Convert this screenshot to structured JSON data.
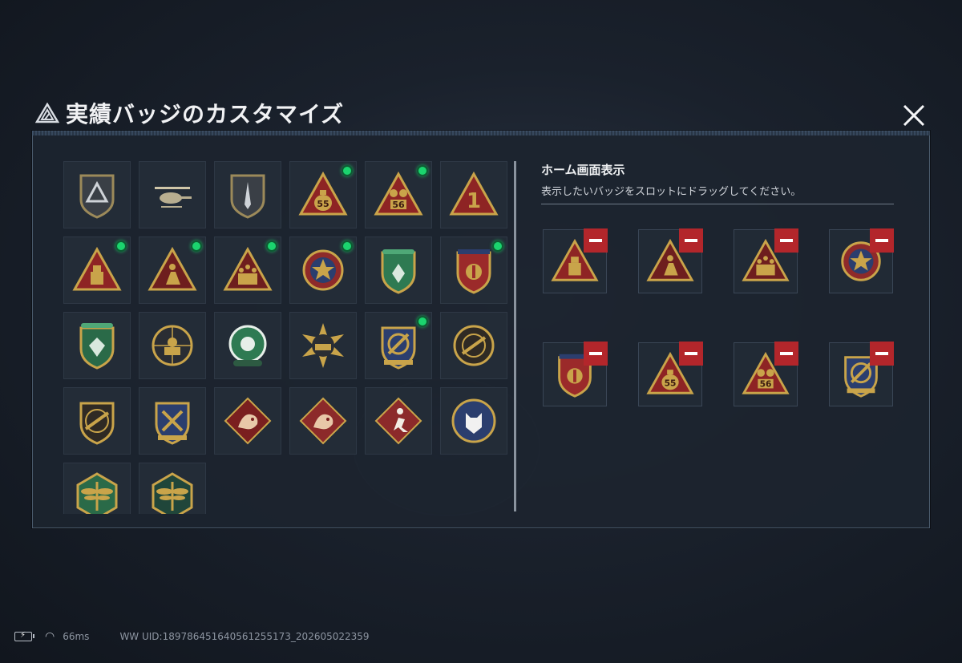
{
  "header": {
    "title": "実績バッジのカスタマイズ"
  },
  "right_panel": {
    "title": "ホーム画面表示",
    "description": "表示したいバッジをスロットにドラッグしてください。"
  },
  "badges": [
    {
      "icon": "delta-shield-badge-icon",
      "new": false
    },
    {
      "icon": "helicopter-badge-icon",
      "new": false
    },
    {
      "icon": "dagger-shield-badge-icon",
      "new": false
    },
    {
      "icon": "money-bag-55-badge-icon",
      "new": true,
      "label": "55"
    },
    {
      "icon": "chest-56-badge-icon",
      "new": true,
      "label": "56"
    },
    {
      "icon": "number-one-badge-icon",
      "new": false,
      "label": "1"
    },
    {
      "icon": "usb-triangle-badge-icon",
      "new": true
    },
    {
      "icon": "kneeling-soldier-badge-icon",
      "new": true
    },
    {
      "icon": "squad-triangle-badge-icon",
      "new": true
    },
    {
      "icon": "star-medal-badge-icon",
      "new": true
    },
    {
      "icon": "green-shield-badge-icon",
      "new": false
    },
    {
      "icon": "eagle-shield-badge-icon",
      "new": true
    },
    {
      "icon": "green-diamond-shield-badge-icon",
      "new": false
    },
    {
      "icon": "sniper-target-badge-icon",
      "new": false
    },
    {
      "icon": "green-gear-badge-icon",
      "new": false
    },
    {
      "icon": "tank-starburst-badge-icon",
      "new": false
    },
    {
      "icon": "crosshair-wing-badge-icon",
      "new": true
    },
    {
      "icon": "rifle-circle-badge-icon",
      "new": false
    },
    {
      "icon": "rifle-shield-badge-icon",
      "new": false
    },
    {
      "icon": "crossed-rifle-shield-badge-icon",
      "new": false
    },
    {
      "icon": "dragon-red-badge-icon",
      "new": false
    },
    {
      "icon": "dragon-crimson-badge-icon",
      "new": false
    },
    {
      "icon": "runner-diamond-badge-icon",
      "new": false
    },
    {
      "icon": "wolf-circle-badge-icon",
      "new": false
    },
    {
      "icon": "dragonfly-green-badge-icon",
      "new": false
    },
    {
      "icon": "dragonfly-dark-badge-icon",
      "new": false
    }
  ],
  "slots": [
    {
      "icon": "usb-triangle-badge-icon"
    },
    {
      "icon": "kneeling-soldier-badge-icon"
    },
    {
      "icon": "squad-triangle-badge-icon"
    },
    {
      "icon": "star-medal-badge-icon"
    },
    {
      "icon": "eagle-shield-badge-icon"
    },
    {
      "icon": "money-bag-55-badge-icon",
      "label": "55"
    },
    {
      "icon": "chest-56-badge-icon",
      "label": "56"
    },
    {
      "icon": "crosshair-wing-badge-icon"
    }
  ],
  "status_bar": {
    "ping": "66ms",
    "uid": "WW UID:18978645164056125517​3_202605022359"
  },
  "colors": {
    "gold": "#c9a44a",
    "red": "#8e2424",
    "green": "#2e7a52",
    "navy": "#2b3e6e",
    "new_dot": "#1bd46e",
    "remove": "#b3262b"
  }
}
